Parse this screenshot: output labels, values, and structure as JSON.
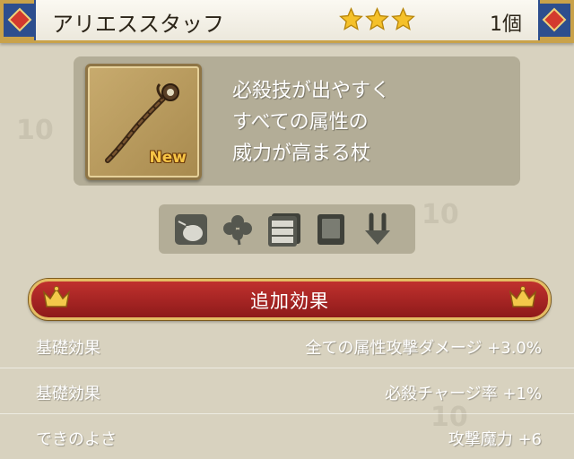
{
  "header": {
    "item_name": "アリエススタッフ",
    "star_count": 3,
    "count": "1個"
  },
  "item": {
    "new_badge": "New",
    "description_lines": [
      "必殺技が出やすく",
      "すべての属性の",
      "威力が高まる杖"
    ]
  },
  "equip_icons": [
    "pouch-icon",
    "clover-icon",
    "cabinet-icon",
    "book-icon",
    "anchor-icon"
  ],
  "effects_banner": {
    "title": "追加効果"
  },
  "effects": [
    {
      "label": "基礎効果",
      "value": "全ての属性攻撃ダメージ +3.0%"
    },
    {
      "label": "基礎効果",
      "value": "必殺チャージ率 +1%"
    },
    {
      "label": "できのよさ",
      "value": "攻撃魔力 +6"
    }
  ],
  "colors": {
    "banner_red": "#b02a28",
    "gold_border": "#e4bc63",
    "star": "#f5c12a",
    "new_badge": "#f7c546"
  }
}
